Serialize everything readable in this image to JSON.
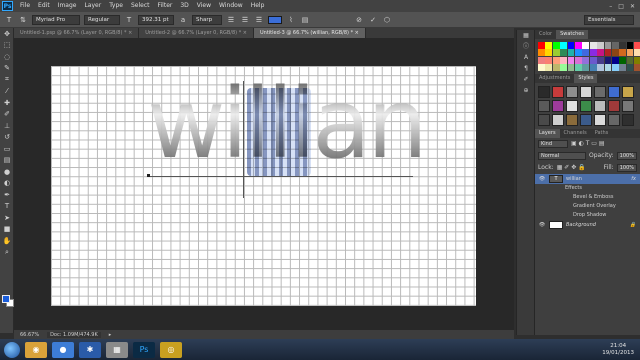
{
  "app": {
    "logo": "Ps"
  },
  "menu": [
    "File",
    "Edit",
    "Image",
    "Layer",
    "Type",
    "Select",
    "Filter",
    "3D",
    "View",
    "Window",
    "Help"
  ],
  "window_controls": [
    "–",
    "□",
    "✕"
  ],
  "options_bar": {
    "font_family": "Myriad Pro",
    "font_style": "Regular",
    "font_size": "392.31 pt",
    "antialias": "Sharp",
    "workspace": "Essentials"
  },
  "tabs": [
    {
      "label": "Untitled-1.psp @ 66.7% (Layer 0, RGB/8) * ×",
      "active": false
    },
    {
      "label": "Untitled-2 @ 66.7% (Layer 0, RGB/8) * ×",
      "active": false
    },
    {
      "label": "Untitled-3 @ 66.7% (willian, RGB/8) * ×",
      "active": true
    }
  ],
  "canvas": {
    "text": "willian"
  },
  "status": {
    "zoom": "66.67%",
    "doc": "Doc: 1.09M/474.9K"
  },
  "panels": {
    "color_tabs": [
      "Color",
      "Swatches"
    ],
    "adjust_tabs": [
      "Adjustments",
      "Styles"
    ],
    "layers_tabs": [
      "Layers",
      "Channels",
      "Paths"
    ],
    "kind": "Kind",
    "blend_mode": "Normal",
    "opacity_label": "Opacity:",
    "opacity": "100%",
    "lock_label": "Lock:",
    "fill_label": "Fill:",
    "fill": "100%",
    "layers": [
      {
        "name": "willian",
        "fx": "fx"
      },
      {
        "name": "Background"
      }
    ],
    "effects_label": "Effects",
    "effects": [
      "Bevel & Emboss",
      "Gradient Overlay",
      "Drop Shadow"
    ]
  },
  "swatch_colors": [
    "#ff0000",
    "#ffff00",
    "#00ff00",
    "#00ffff",
    "#0000ff",
    "#ff00ff",
    "#ffffff",
    "#e6e6e6",
    "#cccccc",
    "#999999",
    "#666666",
    "#333333",
    "#000000",
    "#ff4d4d",
    "#ff8c00",
    "#ffd700",
    "#9acd32",
    "#2e8b57",
    "#20b2aa",
    "#1e90ff",
    "#4169e1",
    "#8a2be2",
    "#c71585",
    "#b22222",
    "#8b4513",
    "#d2691e",
    "#f4a460",
    "#ffdead",
    "#f08080",
    "#fa8072",
    "#ffa07a",
    "#ffb6c1",
    "#ee82ee",
    "#da70d6",
    "#9370db",
    "#6a5acd",
    "#483d8b",
    "#191970",
    "#00008b",
    "#006400",
    "#556b2f",
    "#808000",
    "#fffacd",
    "#eee8aa",
    "#bdb76b",
    "#98fb98",
    "#8fbc8f",
    "#66cdaa",
    "#5f9ea0",
    "#4682b4",
    "#b0c4de",
    "#add8e6",
    "#87cefa",
    "#708090",
    "#2f4f4f",
    "#a0522d"
  ],
  "style_colors": [
    "#2a2a2a",
    "#c63b3b",
    "#8e8e8e",
    "#d7d7d7",
    "#6b6b6b",
    "#3f6ccf",
    "#c7a54a",
    "#5a5a5a",
    "#9d3b9b",
    "#e0e0e0",
    "#3c8c4a",
    "#bbbbbb",
    "#a03a3a",
    "#787878",
    "#4a4a4a",
    "#cfcfcf",
    "#8a6b3b",
    "#3b5b8b",
    "#dadada",
    "#676767",
    "#2f2f2f"
  ],
  "taskbar": {
    "apps": [
      "◉",
      "●",
      "✱",
      "▦",
      "Ps",
      "◎"
    ],
    "time": "21:04",
    "date": "19/01/2013"
  }
}
